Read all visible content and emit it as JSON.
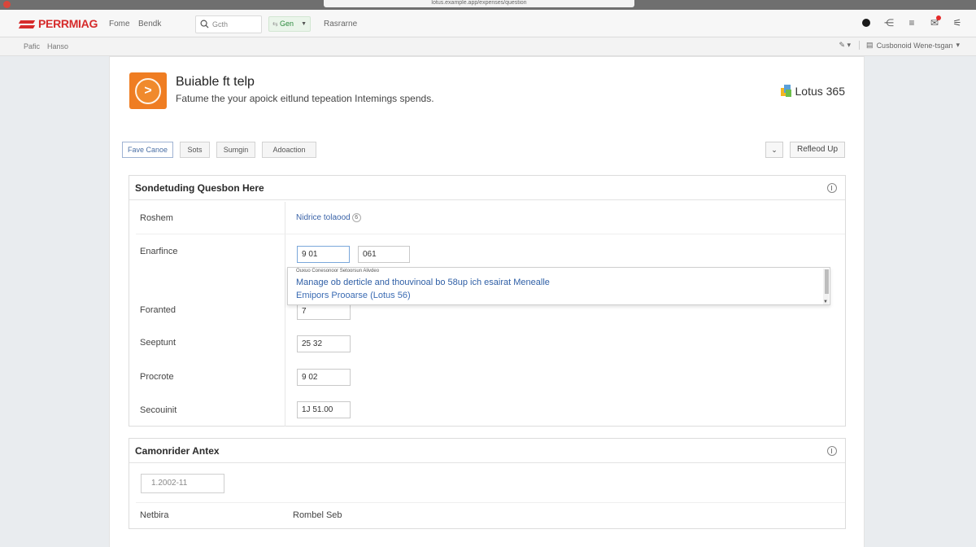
{
  "browser": {
    "url": "lotus.example.app/expenses/question"
  },
  "appbar": {
    "brand": "PERRMIAG",
    "nav": [
      "Fome",
      "Bendk"
    ],
    "search_placeholder": "Gcth",
    "filter_value": "Gen",
    "extra_nav": "Rasrarne"
  },
  "subbar": {
    "crumbs": [
      "Pafic",
      "Hanso"
    ],
    "workspace": "Cusbonoid Wene-tsgan"
  },
  "header": {
    "title": "Buiable ft telp",
    "subtitle": "Fatume the your apoick eitlund tepeation Intemings spends.",
    "brand": "Lotus 365"
  },
  "tabs": [
    "Fave Canoe",
    "Sots",
    "Sumgin",
    "Adoaction"
  ],
  "actions": {
    "chevron": "⌄",
    "refresh": "Refleod Up"
  },
  "section1": {
    "title": "Sondetuding Quesbon Here",
    "rows": [
      {
        "label": "Roshem",
        "value": "Nidrice tolaood",
        "hint": "6"
      },
      {
        "label": "Enarfince",
        "values": [
          "9  01",
          "061"
        ]
      },
      {
        "label": "Foranted",
        "values": [
          "7"
        ]
      },
      {
        "label": "Seeptunt",
        "values": [
          "25  32"
        ]
      },
      {
        "label": "Procrote",
        "values": [
          "9  02"
        ]
      },
      {
        "label": "Secouinit",
        "values": [
          "1J  51.00"
        ]
      }
    ],
    "dropdown": {
      "header": "Ouxuo Conesonoor  Setoorsun Alivdeo",
      "items": [
        "Manage ob derticle and thouvinoal bo 58up ich esairat Menealle",
        "Emipors Prooarse (Lotus 56)"
      ]
    }
  },
  "section2": {
    "title": "Camonrider Antex",
    "date_value": "1.2002-11",
    "row": {
      "label": "Netbira",
      "value": "Rombel Seb"
    }
  }
}
